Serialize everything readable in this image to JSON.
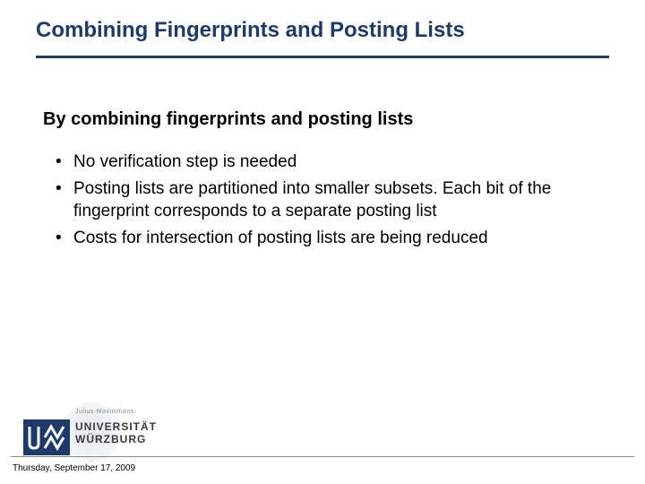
{
  "title": "Combining Fingerprints and Posting Lists",
  "subhead": "By combining fingerprints and posting lists",
  "bullets": [
    "No verification step is needed",
    "Posting lists are partitioned into smaller subsets. Each bit of the fingerprint corresponds to a separate posting list",
    "Costs for intersection of posting lists are being reduced"
  ],
  "logo": {
    "jm": "Julius-Maximilians-",
    "line1": "UNIVERSITÄT",
    "line2": "WÜRZBURG"
  },
  "footer_date": "Thursday, September 17, 2009"
}
